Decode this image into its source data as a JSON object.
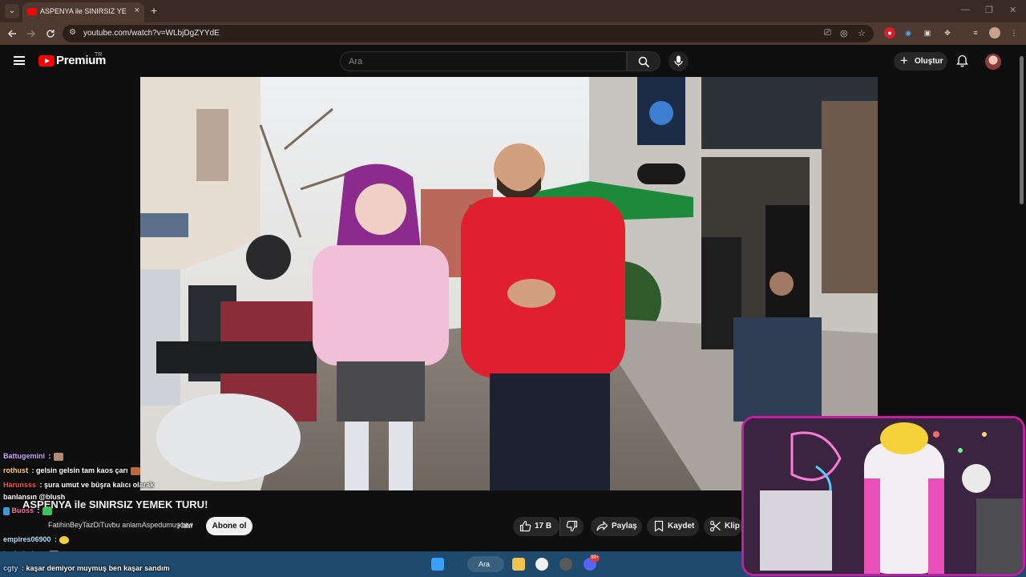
{
  "browser": {
    "tab_title": "ASPENYA ile SINIRSIZ YEMEK TU",
    "url": "youtube.com/watch?v=WLbjDgZYYdE",
    "new_tab_glyph": "+",
    "close_glyph": "×"
  },
  "youtube": {
    "brand": "Premium",
    "region": "TR",
    "search_placeholder": "Ara",
    "create_label": "Oluştur"
  },
  "video": {
    "title": "ASPENYA ile SINIRSIZ YEMEK TURU!",
    "channel_overlap_text": "FatihinBeyTazDiTuvbu anlamAspedumuş btw",
    "join_label": "Katıl",
    "subscribe_label": "Abone ol",
    "like_count": "17 B",
    "share_label": "Paylaş",
    "save_label": "Kaydet",
    "clip_label": "Klip"
  },
  "chat": [
    {
      "user": "Battugemini",
      "sep": " :",
      "message": "",
      "user_color": "#c9a6ff"
    },
    {
      "user": "rothust",
      "sep": " :",
      "message": " gelsin gelsin tam kaos çarı",
      "user_color": "#ffd166"
    },
    {
      "user": "Harunsss",
      "sep": " :",
      "message": " şura umut ve büşra kalıcı olarak",
      "user_color": "#ff4d4d"
    },
    {
      "user": "",
      "sep": "",
      "message": "banlansın @blush",
      "user_color": "#ffffff"
    },
    {
      "user": "Buoss",
      "sep": " :",
      "message": "",
      "user_color": "#ff6fae"
    },
    {
      "user": "empires06900",
      "sep": " :",
      "message": "",
      "user_color": "#b0e0ff"
    },
    {
      "user": "barisderler",
      "sep": " :",
      "message": "",
      "user_color": "#c9a6ff"
    },
    {
      "user": "cgty",
      "sep": " :",
      "message": " kaşar demiyor muymuş ben kaşar sandım",
      "user_color": "#9ad0ff"
    }
  ],
  "taskbar": {
    "search_label": "Ara",
    "badge": "99+"
  },
  "icons": {
    "back": "back-arrow-icon",
    "forward": "forward-arrow-icon",
    "reload": "reload-icon",
    "search": "search-icon",
    "mic": "mic-icon",
    "bell": "bell-icon",
    "like": "thumbs-up-icon",
    "dislike": "thumbs-down-icon",
    "share": "share-icon",
    "save": "bookmark-icon",
    "clip": "scissors-icon"
  },
  "colors": {
    "tab_bar": "#3a2a24",
    "toolbar": "#4f3a31",
    "yt_red": "#ff0000",
    "webcam_border": "#c01fa0",
    "taskbar": "#1e4a6e"
  }
}
